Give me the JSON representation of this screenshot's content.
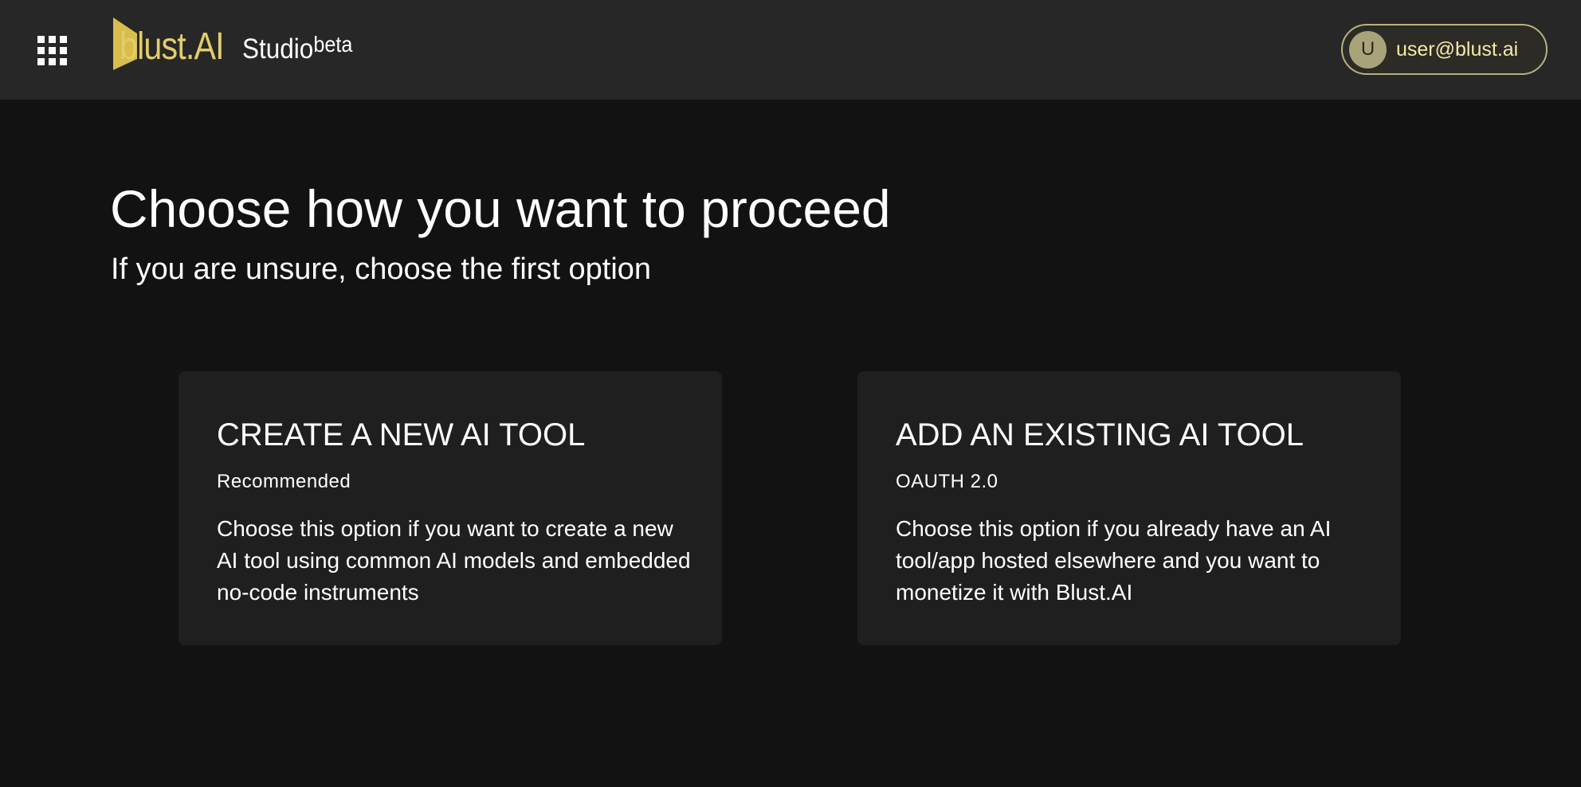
{
  "header": {
    "apps_icon": "apps-grid-icon",
    "logo_text": "blust.AI",
    "product": "Studio",
    "product_badge": "beta",
    "brand_color": "#e3cd6a",
    "user": {
      "initial": "U",
      "email": "user@blust.ai"
    }
  },
  "main": {
    "title": "Choose how you want to proceed",
    "subtitle": "If you are unsure, choose the first option",
    "options": [
      {
        "title": "CREATE A NEW AI TOOL",
        "tag": "Recommended",
        "description": "Choose this option if you want to create a new AI tool using common AI models and embedded no-code instruments"
      },
      {
        "title": "ADD AN EXISTING AI TOOL",
        "tag": "OAUTH 2.0",
        "description": "Choose this option if you already have an AI tool/app hosted elsewhere and you want to monetize it with Blust.AI"
      }
    ]
  }
}
